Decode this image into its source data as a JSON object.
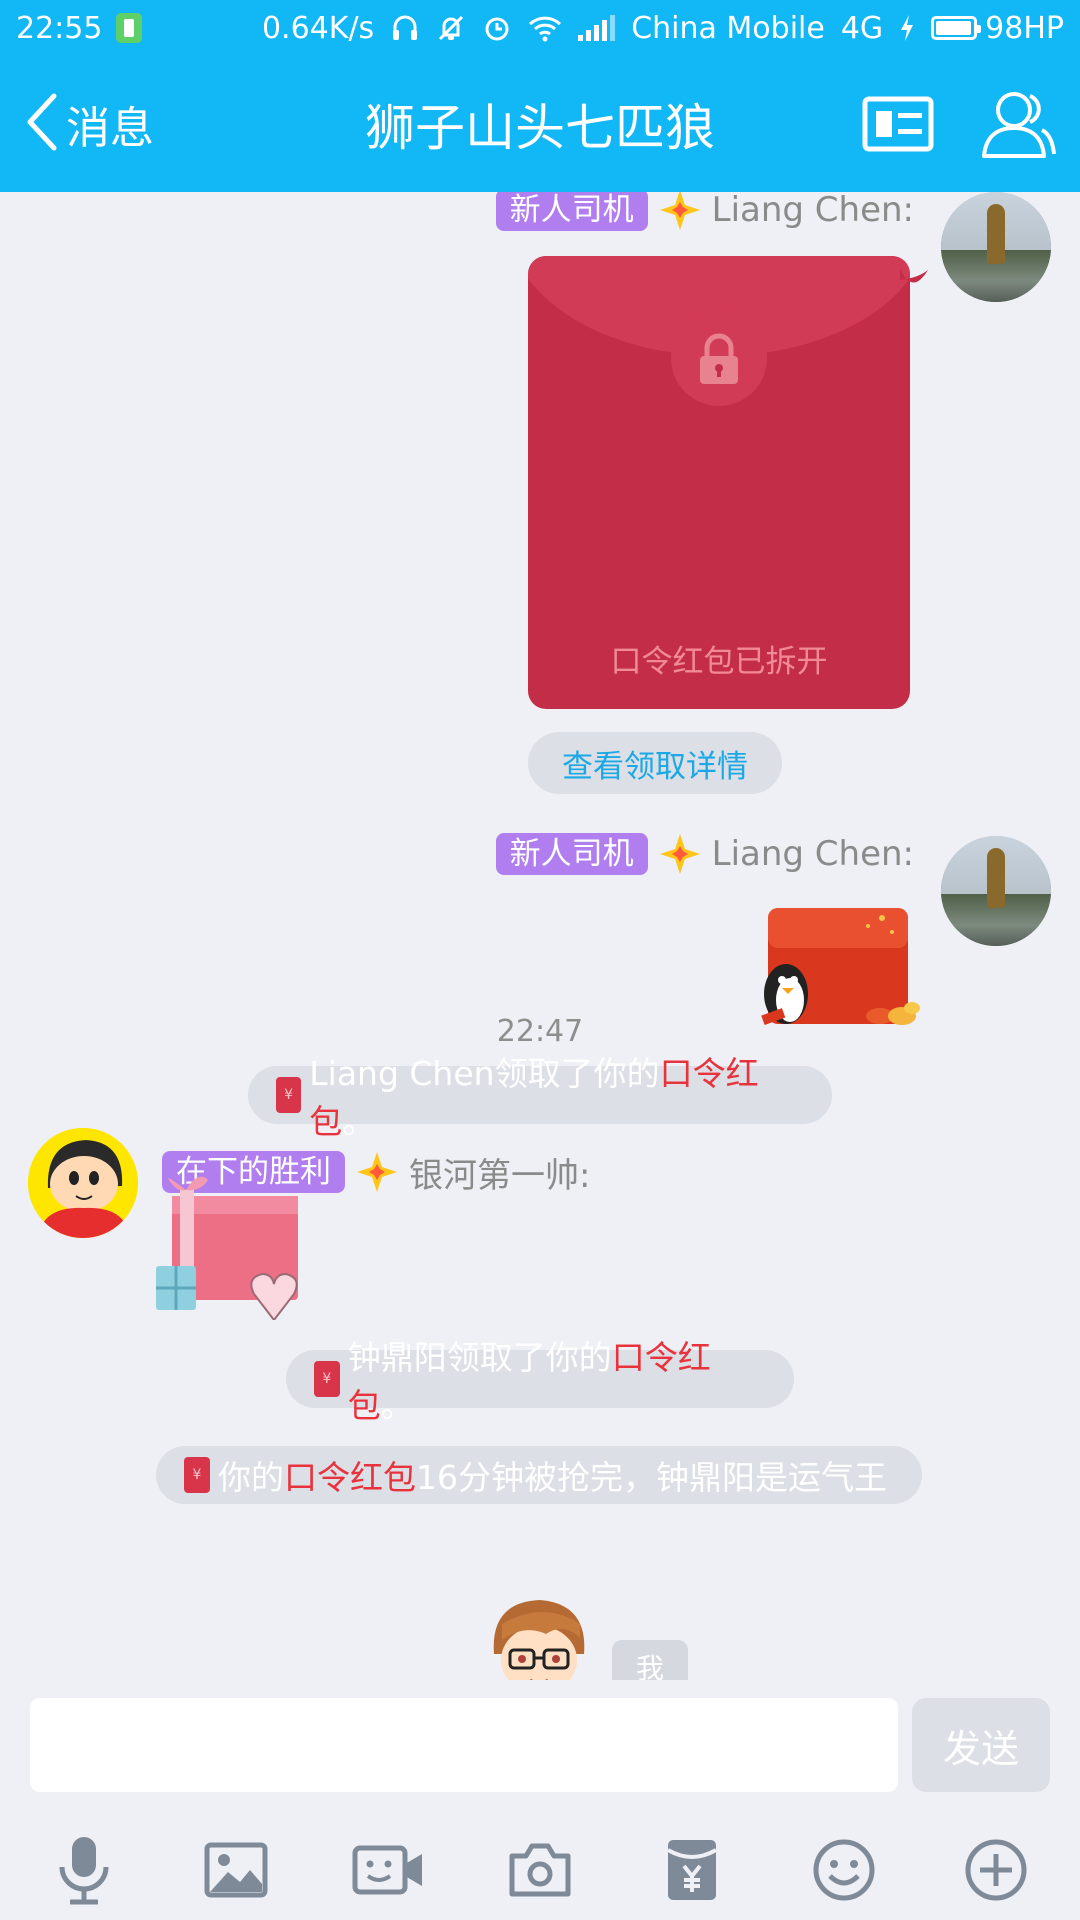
{
  "status_bar": {
    "time": "22:55",
    "net_speed": "0.64K/s",
    "carrier": "China Mobile",
    "network_type": "4G",
    "battery": "98HP",
    "battery_level_pct": 98,
    "icons": [
      "battery-saver-icon",
      "headphones-icon",
      "mute-icon",
      "alarm-icon",
      "wifi-icon",
      "signal-icon",
      "charging-icon",
      "battery-icon"
    ]
  },
  "header": {
    "back_label": "消息",
    "title": "狮子山头七匹狼",
    "icons": [
      "back-chevron-icon",
      "group-card-icon",
      "members-icon"
    ],
    "accent_color": "#12b7f5"
  },
  "messages": {
    "m1": {
      "badge": "新人司机",
      "sender": "Liang Chen:",
      "red_packet_status": "口令红包已拆开",
      "detail_link": "查看领取详情"
    },
    "m2": {
      "badge": "新人司机",
      "sender": "Liang Chen:"
    },
    "sys1": {
      "prefix": "Liang Chen领取了你的",
      "highlight": "口令红包",
      "suffix": "。"
    },
    "timestamp": "22:47",
    "m3": {
      "badge": "在下的胜利",
      "sender": "银河第一帅:"
    },
    "sys2": {
      "prefix": "钟鼎阳领取了你的",
      "highlight": "口令红包",
      "suffix": "。"
    },
    "sys3": {
      "prefix": "你的",
      "highlight": "口令红包",
      "suffix": "16分钟被抢完，钟鼎阳是运气王"
    },
    "me_tag": "我"
  },
  "input": {
    "value": "",
    "send_label": "发送"
  },
  "toolbar": {
    "icons": [
      "microphone-icon",
      "image-icon",
      "video-call-icon",
      "camera-icon",
      "red-packet-icon",
      "emoji-icon",
      "plus-icon"
    ]
  },
  "colors": {
    "badge": "#b17ef0",
    "red_packet": "#c42d48",
    "highlight_red": "#e8333c",
    "link_blue": "#1aa8e6"
  }
}
